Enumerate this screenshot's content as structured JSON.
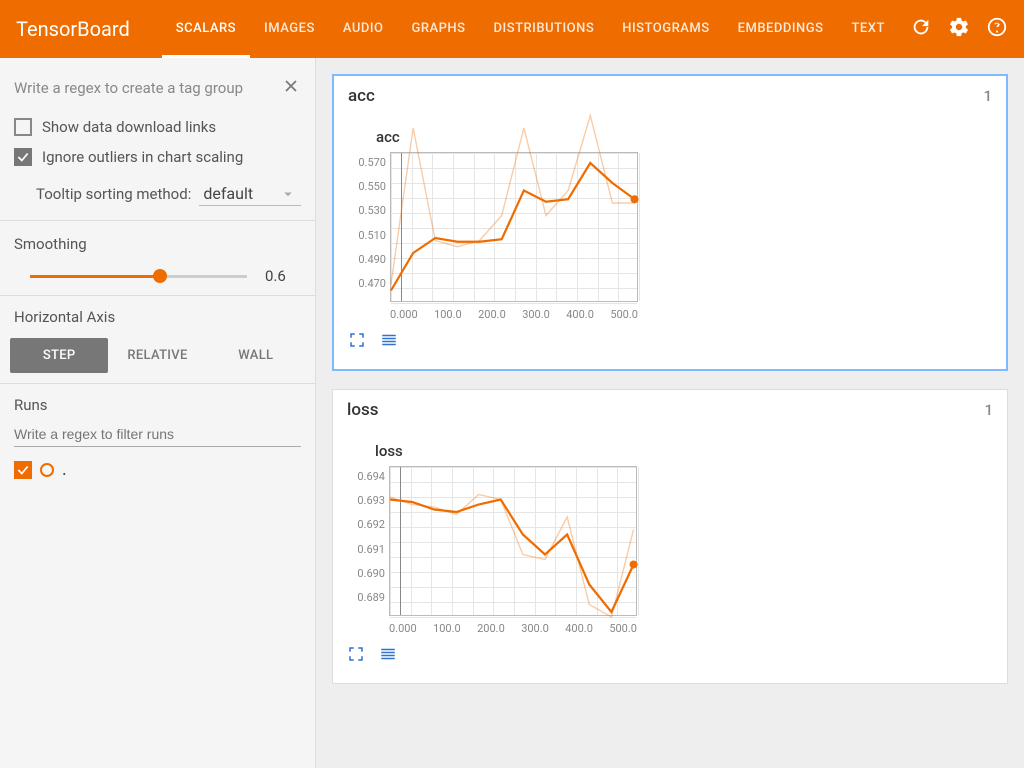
{
  "topbar": {
    "logo": "TensorBoard",
    "tabs": [
      "SCALARS",
      "IMAGES",
      "AUDIO",
      "GRAPHS",
      "DISTRIBUTIONS",
      "HISTOGRAMS",
      "EMBEDDINGS",
      "TEXT"
    ],
    "active_tab_index": 0
  },
  "sidebar": {
    "tag_group_placeholder": "Write a regex to create a tag group",
    "show_download_links": {
      "label": "Show data download links",
      "checked": false
    },
    "ignore_outliers": {
      "label": "Ignore outliers in chart scaling",
      "checked": true
    },
    "tooltip_sort": {
      "label": "Tooltip sorting method:",
      "value": "default"
    },
    "smoothing": {
      "label": "Smoothing",
      "value": 0.6,
      "value_text": "0.6"
    },
    "horizontal_axis": {
      "label": "Horizontal Axis",
      "options": [
        "STEP",
        "RELATIVE",
        "WALL"
      ],
      "active_index": 0
    },
    "runs": {
      "label": "Runs",
      "filter_placeholder": "Write a regex to filter runs",
      "items": [
        {
          "name": ".",
          "checked": true,
          "color": "#ef6c00"
        }
      ]
    }
  },
  "cards": [
    {
      "name": "acc",
      "count": "1",
      "chart_title": "acc",
      "chart_index": 0,
      "focused": true
    },
    {
      "name": "loss",
      "count": "1",
      "chart_title": "loss",
      "chart_index": 1,
      "focused": false
    }
  ],
  "x_ticks": [
    "0.000",
    "100.0",
    "200.0",
    "300.0",
    "400.0",
    "500.0"
  ],
  "chart_data": [
    {
      "type": "line",
      "title": "acc",
      "xlabel": "",
      "ylabel": "",
      "x": [
        0,
        50,
        100,
        150,
        200,
        250,
        300,
        350,
        400,
        450,
        500,
        550
      ],
      "series": [
        {
          "name": "smoothed",
          "color": "#ef6c00",
          "values": [
            0.47,
            0.5,
            0.512,
            0.509,
            0.509,
            0.511,
            0.55,
            0.541,
            0.543,
            0.572,
            0.556,
            0.543
          ]
        },
        {
          "name": "raw",
          "color": "rgba(239,108,0,0.35)",
          "values": [
            0.475,
            0.6,
            0.51,
            0.505,
            0.51,
            0.53,
            0.6,
            0.53,
            0.55,
            0.61,
            0.54,
            0.54
          ]
        }
      ],
      "y_ticks": [
        0.47,
        0.49,
        0.51,
        0.53,
        0.55,
        0.57
      ],
      "ylim": [
        0.46,
        0.58
      ],
      "xlim": [
        0,
        560
      ]
    },
    {
      "type": "line",
      "title": "loss",
      "xlabel": "",
      "ylabel": "",
      "x": [
        0,
        50,
        100,
        150,
        200,
        250,
        300,
        350,
        400,
        450,
        500,
        550
      ],
      "series": [
        {
          "name": "smoothed",
          "color": "#ef6c00",
          "values": [
            0.6932,
            0.6931,
            0.6928,
            0.6927,
            0.693,
            0.6932,
            0.6918,
            0.691,
            0.6918,
            0.6898,
            0.6887,
            0.6906
          ]
        },
        {
          "name": "raw",
          "color": "rgba(239,108,0,0.35)",
          "values": [
            0.6933,
            0.693,
            0.6929,
            0.6926,
            0.6934,
            0.6932,
            0.691,
            0.6908,
            0.6925,
            0.689,
            0.6885,
            0.692
          ]
        }
      ],
      "y_ticks": [
        0.689,
        0.69,
        0.691,
        0.692,
        0.693,
        0.694
      ],
      "ylim": [
        0.6885,
        0.6945
      ],
      "xlim": [
        0,
        560
      ]
    }
  ],
  "colors": {
    "accent": "#ef6c00",
    "icon_blue": "#2e72d2"
  }
}
